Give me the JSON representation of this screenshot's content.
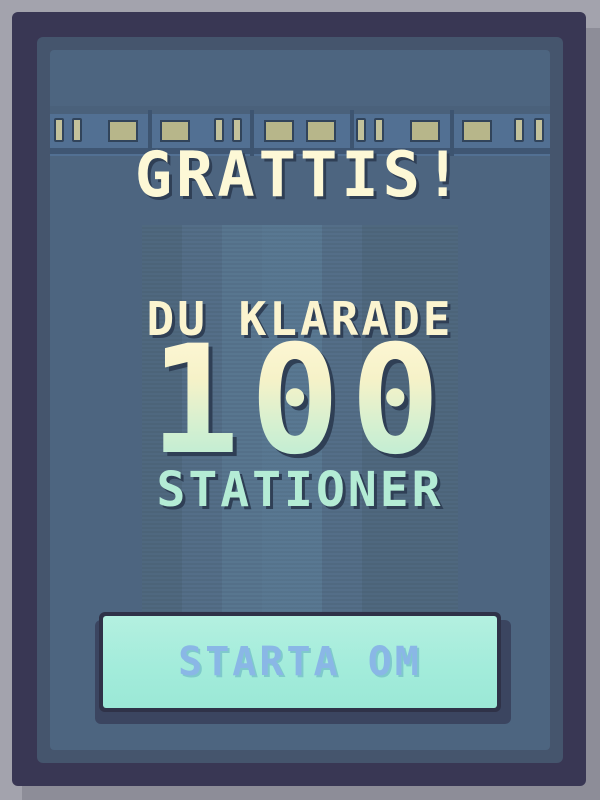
{
  "screen": {
    "title": "GRATTIS!",
    "message_line1": "DU KLARADE",
    "count": "100",
    "message_line2": "STATIONER"
  },
  "actions": {
    "restart_label": "STARTA OM"
  },
  "decor": {
    "icon": "subway-train-icon"
  },
  "colors": {
    "frame": "#393754",
    "panel": "#4d6580",
    "title_text": "#fdf8d6",
    "accent_text": "#b4ecd5",
    "button": "#a3ecdb",
    "button_text": "#8ab7e6"
  }
}
